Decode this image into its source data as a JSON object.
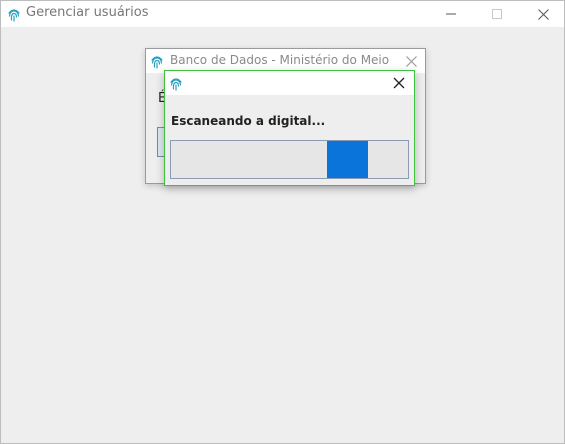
{
  "main_window": {
    "title": "Gerenciar usuários",
    "icon": "fingerprint-icon",
    "controls": [
      "minimize-icon",
      "maximize-icon",
      "close-icon"
    ]
  },
  "background_dialog": {
    "title": "Banco de Dados - Ministério do Meio A...",
    "icon": "fingerprint-icon",
    "label_visible": "É"
  },
  "scan_dialog": {
    "icon": "fingerprint-icon",
    "message": "Escaneando a digital...",
    "progress": {
      "indeterminate": true,
      "indicator_start_fraction": 0.66,
      "indicator_width_fraction": 0.17,
      "color": "#0a74da"
    },
    "border_color": "#3ec23e"
  }
}
